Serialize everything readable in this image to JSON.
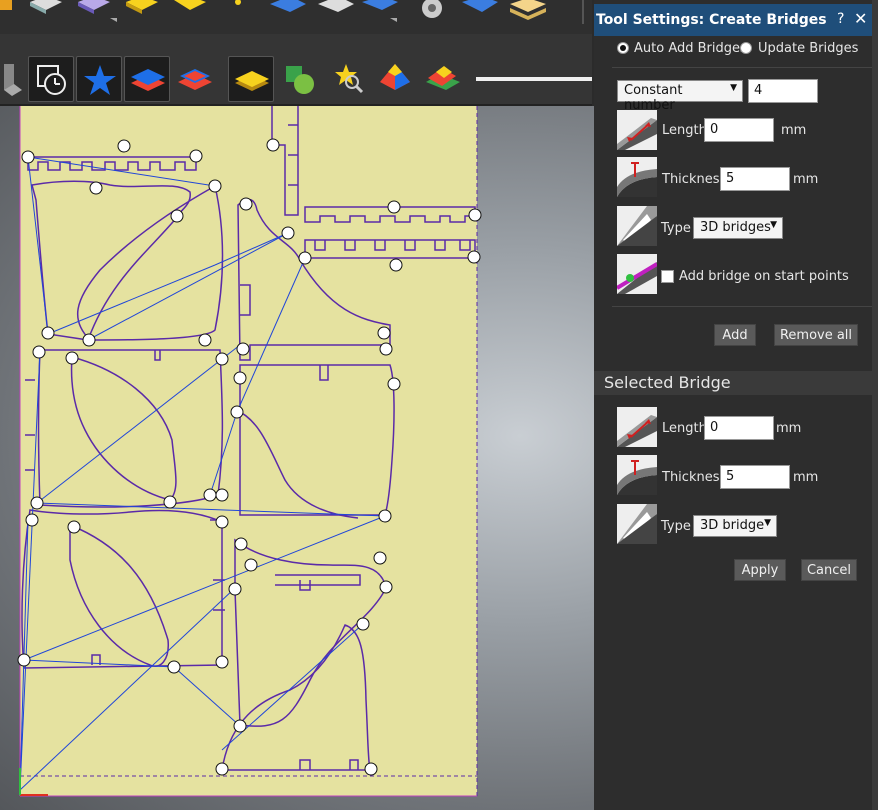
{
  "panel": {
    "title": "Tool Settings: Create Bridges",
    "help": "?",
    "close": "✕",
    "mode": {
      "auto_label": "Auto Add Bridges",
      "update_label": "Update Bridges",
      "selected": "auto"
    },
    "count_mode": "Constant number",
    "count_value": "4",
    "length_label": "Length",
    "length_value": "0",
    "length_unit": "mm",
    "thickness_label": "Thickness",
    "thickness_value": "5",
    "thickness_unit": "mm",
    "type_label": "Type",
    "type_value": "3D bridges",
    "start_points_label": "Add bridge on start points",
    "start_points_checked": false,
    "add_button": "Add",
    "remove_all_button": "Remove all"
  },
  "selected_bridge": {
    "heading": "Selected Bridge",
    "length_label": "Length",
    "length_value": "0",
    "length_unit": "mm",
    "thickness_label": "Thickness",
    "thickness_value": "5",
    "thickness_unit": "mm",
    "type_label": "Type",
    "type_value": "3D bridge",
    "apply_button": "Apply",
    "cancel_button": "Cancel"
  },
  "toolbar": {
    "tools": [
      {
        "icon": "transform-icon"
      },
      {
        "icon": "history-icon"
      },
      {
        "icon": "star-shape-icon"
      },
      {
        "icon": "layer-blue-icon"
      },
      {
        "icon": "layer-red-icon"
      },
      {
        "icon": "layer-yellow-icon"
      },
      {
        "icon": "node-edit-icon"
      },
      {
        "icon": "find-star-icon"
      },
      {
        "icon": "pyramid-icon"
      },
      {
        "icon": "color-layers-icon"
      }
    ]
  },
  "colors": {
    "sheet": "#e5e2a0",
    "toolpath": "#5b2aa8",
    "bridge_marker": "#ffffff",
    "link_line": "#2046d8",
    "panel_title": "#1f4e7a"
  }
}
